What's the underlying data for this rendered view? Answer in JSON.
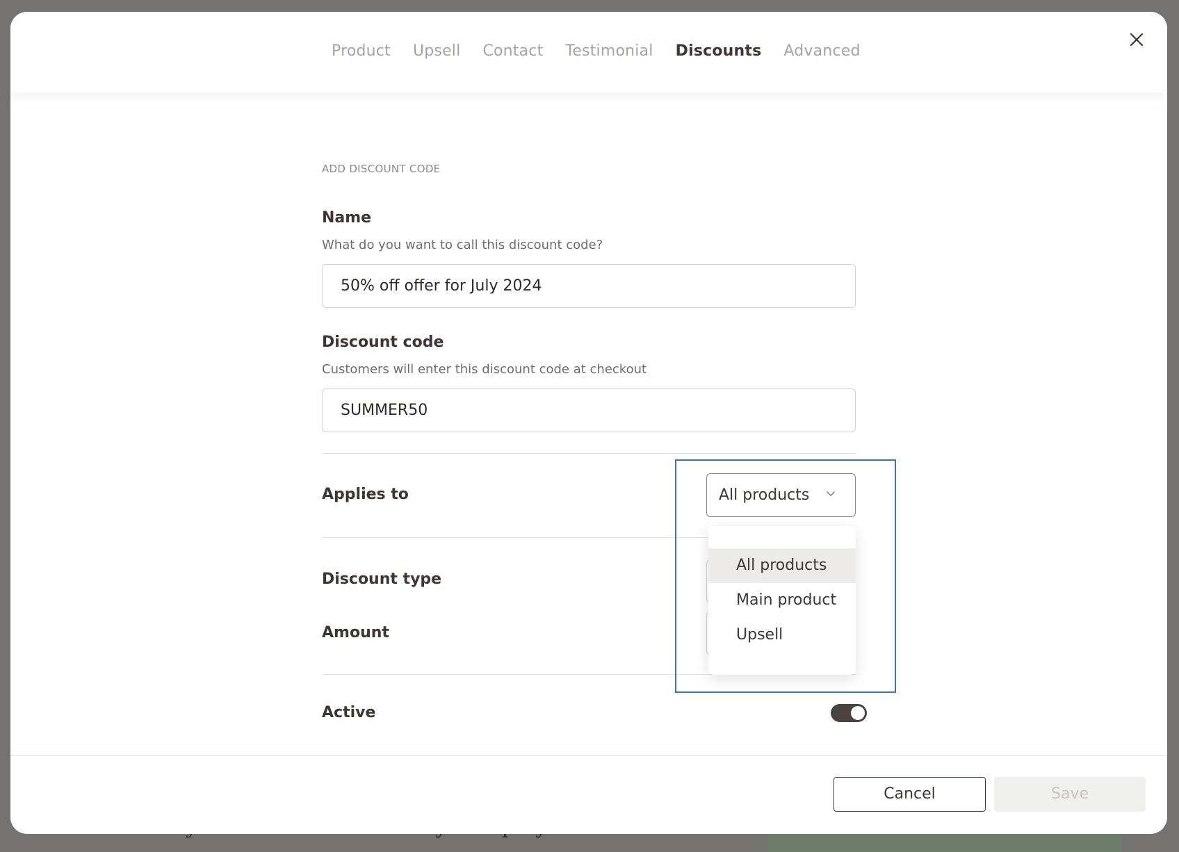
{
  "background": {
    "text_line": "they were to create. Audrey's step-by"
  },
  "tabs": [
    {
      "label": "Product",
      "active": false
    },
    {
      "label": "Upsell",
      "active": false
    },
    {
      "label": "Contact",
      "active": false
    },
    {
      "label": "Testimonial",
      "active": false
    },
    {
      "label": "Discounts",
      "active": true
    },
    {
      "label": "Advanced",
      "active": false
    }
  ],
  "form": {
    "section_title": "ADD DISCOUNT CODE",
    "name": {
      "label": "Name",
      "help": "What do you want to call this discount code?",
      "value": "50% off offer for July 2024"
    },
    "discount_code": {
      "label": "Discount code",
      "help": "Customers will enter this discount code at checkout",
      "value": "SUMMER50"
    },
    "applies_to": {
      "label": "Applies to",
      "selected": "All products",
      "options": [
        "All products",
        "Main product",
        "Upsell"
      ]
    },
    "discount_type": {
      "label": "Discount type"
    },
    "amount": {
      "label": "Amount"
    },
    "active": {
      "label": "Active",
      "on": true
    }
  },
  "footer": {
    "cancel_label": "Cancel",
    "save_label": "Save"
  },
  "colors": {
    "accent_highlight": "#3d6fd1",
    "text_primary": "#3f3634",
    "tab_inactive": "#a7a3a1",
    "toggle_on": "#4a4240"
  },
  "icons": {
    "close": "close-icon",
    "dropdown": "chevron-down-icon"
  }
}
